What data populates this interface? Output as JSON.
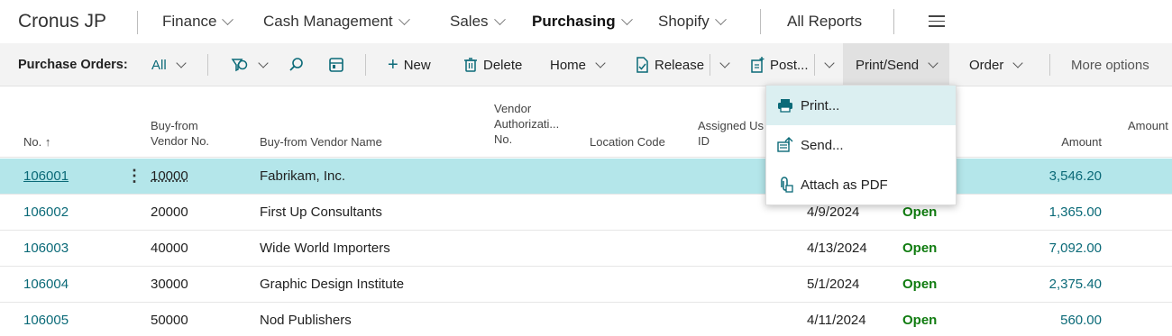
{
  "topnav": {
    "company": "Cronus JP",
    "items": [
      {
        "label": "Finance"
      },
      {
        "label": "Cash Management"
      },
      {
        "label": "Sales"
      },
      {
        "label": "Purchasing"
      },
      {
        "label": "Shopify"
      }
    ],
    "all_reports": "All Reports"
  },
  "actionbar": {
    "title": "Purchase Orders:",
    "filter": "All",
    "new": "New",
    "delete": "Delete",
    "home": "Home",
    "release": "Release",
    "post": "Post...",
    "print_send": "Print/Send",
    "order": "Order",
    "more_options": "More options"
  },
  "table": {
    "headers": {
      "no": "No. ↑",
      "vendor_no": [
        "Buy-from",
        "Vendor No."
      ],
      "vendor_name": "Buy-from Vendor Name",
      "vendor_auth": [
        "Vendor",
        "Authorizati...",
        "No."
      ],
      "location": "Location Code",
      "assigned": [
        "Assigned Us",
        "ID"
      ],
      "amount": "Amount",
      "amount2": "Amount"
    },
    "rows": [
      {
        "no": "106001",
        "vendor_no": "10000",
        "name": "Fabrikam, Inc.",
        "date": "",
        "status": "",
        "amount": "3,546.20"
      },
      {
        "no": "106002",
        "vendor_no": "20000",
        "name": "First Up Consultants",
        "date": "4/9/2024",
        "status": "Open",
        "amount": "1,365.00"
      },
      {
        "no": "106003",
        "vendor_no": "40000",
        "name": "Wide World Importers",
        "date": "4/13/2024",
        "status": "Open",
        "amount": "7,092.00"
      },
      {
        "no": "106004",
        "vendor_no": "30000",
        "name": "Graphic Design Institute",
        "date": "5/1/2024",
        "status": "Open",
        "amount": "2,375.40"
      },
      {
        "no": "106005",
        "vendor_no": "50000",
        "name": "Nod Publishers",
        "date": "4/11/2024",
        "status": "Open",
        "amount": "560.00"
      }
    ]
  },
  "menu": {
    "items": [
      {
        "label": "Print...",
        "icon": "printer-icon"
      },
      {
        "label": "Send...",
        "icon": "send-icon"
      },
      {
        "label": "Attach as PDF",
        "icon": "attach-icon"
      }
    ]
  },
  "colors": {
    "accent": "#0b6a78",
    "selected_row": "#b4e6ea",
    "status_open": "#107c10",
    "menu_hover": "#dbeff1"
  }
}
